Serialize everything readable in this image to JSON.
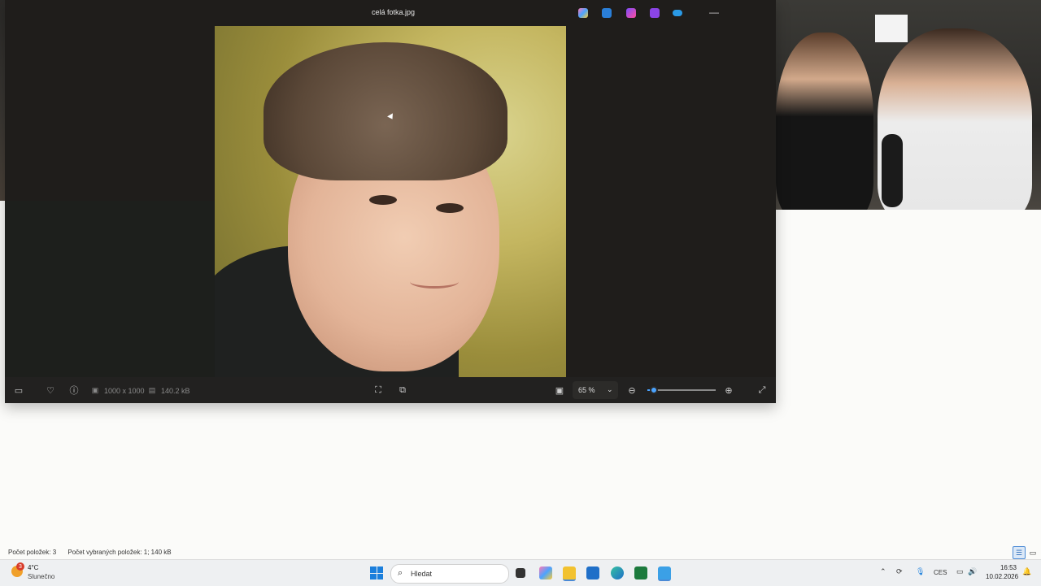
{
  "viewer": {
    "title": "celá fotka.jpg",
    "toolbar": {
      "dimensions": "1000 x 1000",
      "file_size": "140.2 kB",
      "zoom_value": "65 %",
      "zoom_fraction": 0.1
    }
  },
  "explorer_status": {
    "items_count": "Počet položek: 3",
    "selected_count": "Počet vybraných položek: 1; 140 kB"
  },
  "taskbar": {
    "weather_badge": "3",
    "weather_temp": "4°C",
    "weather_desc": "Slunečno",
    "search_placeholder": "Hledat",
    "language": "CES",
    "time": "16:53",
    "date": "10.02.2026"
  },
  "colors": {
    "accent": "#4aa3ff",
    "windows_blue": "#1b7fdc"
  },
  "icons": [
    "info-icon",
    "heart-icon",
    "zoom-in-icon",
    "zoom-out-icon",
    "expand-icon",
    "search-icon",
    "wifi-icon",
    "volume-icon",
    "battery-icon",
    "notification-icon",
    "mic-icon",
    "chevron-up-icon"
  ]
}
